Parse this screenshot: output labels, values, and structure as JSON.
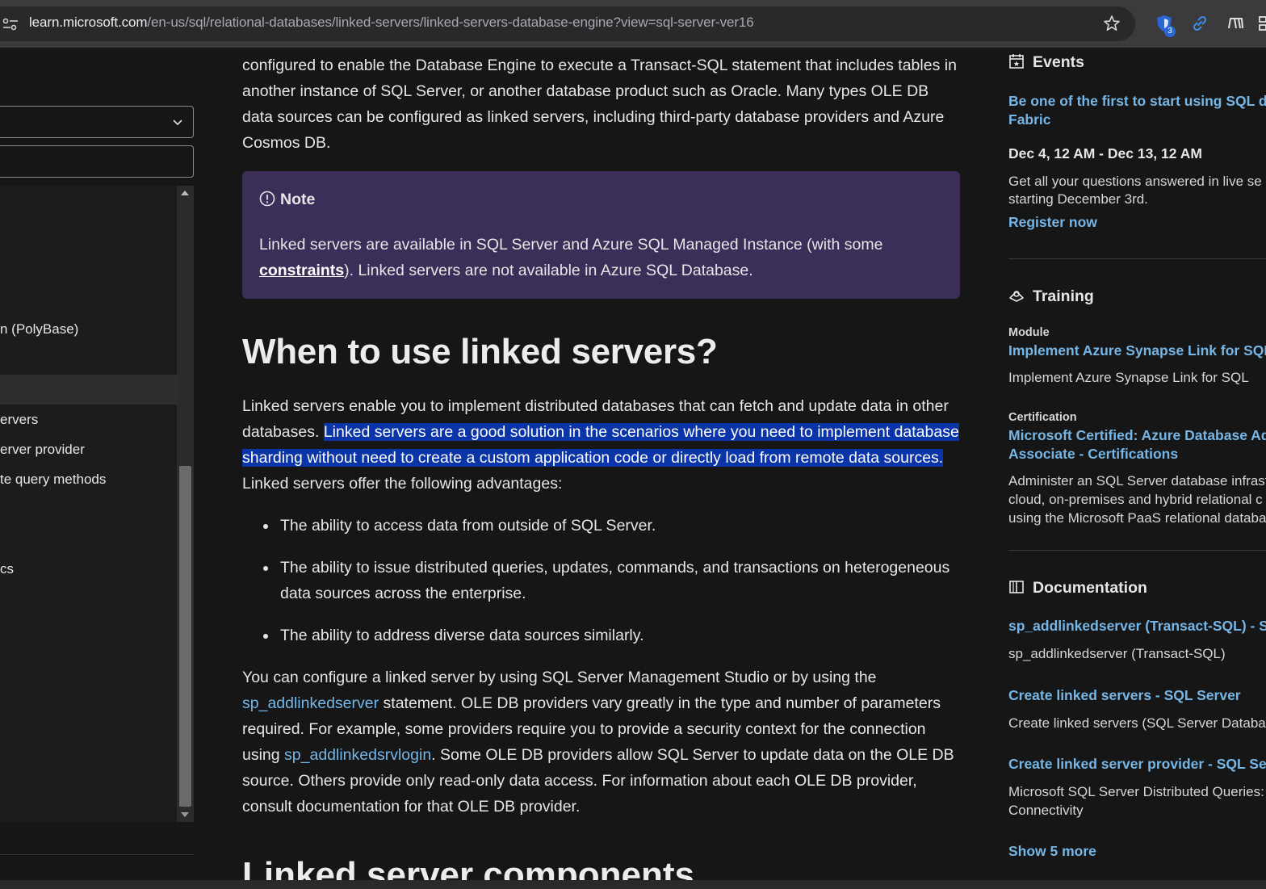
{
  "browser": {
    "url_host": "learn.microsoft.com",
    "url_path": "/en-us/sql/relational-databases/linked-servers/linked-servers-database-engine?view=sql-server-ver16",
    "extension_badge": "3"
  },
  "sidebar": {
    "items": [
      "n (PolyBase)",
      "ervers",
      "erver provider",
      "te query methods",
      "cs"
    ]
  },
  "main": {
    "intro_lines": "configured to enable the Database Engine to execute a Transact-SQL statement that includes tables in another instance of SQL Server, or another database product such as Oracle. Many types OLE DB data sources can be configured as linked servers, including third-party database providers and Azure Cosmos DB.",
    "note": {
      "title": "Note",
      "text_before": "Linked servers are available in SQL Server and Azure SQL Managed Instance (with some ",
      "link": "constraints",
      "text_after": "). Linked servers are not available in Azure SQL Database."
    },
    "heading": "When to use linked servers?",
    "para_start": "Linked servers enable you to implement distributed databases that can fetch and update data in other databases. ",
    "para_highlight": "Linked servers are a good solution in the scenarios where you need to implement database sharding without need to create a custom application code or directly load from remote data sources.",
    "para_end": " Linked servers offer the following advantages:",
    "bullets": [
      "The ability to access data from outside of SQL Server.",
      "The ability to issue distributed queries, updates, commands, and transactions on heterogeneous data sources across the enterprise.",
      "The ability to address diverse data sources similarly."
    ],
    "para3_a": "You can configure a linked server by using SQL Server Management Studio or by using the ",
    "para3_link1": "sp_addlinkedserver",
    "para3_b": " statement. OLE DB providers vary greatly in the type and number of parameters required. For example, some providers require you to provide a security context for the connection using ",
    "para3_link2": "sp_addlinkedsrvlogin",
    "para3_c": ". Some OLE DB providers allow SQL Server to update data on the OLE DB source. Others provide only read-only data access. For information about each OLE DB provider, consult documentation for that OLE DB provider.",
    "next_heading": "Linked server components"
  },
  "rail": {
    "events": {
      "heading": "Events",
      "link_line1": "Be one of the first to start using SQL dat",
      "link_line2": "Fabric",
      "dates": "Dec 4, 12 AM - Dec 13, 12 AM",
      "desc_line1": "Get all your questions answered in live se",
      "desc_line2": "starting December 3rd.",
      "register": "Register now"
    },
    "training": {
      "heading": "Training",
      "module_label": "Module",
      "module_link": "Implement Azure Synapse Link for SQL -",
      "module_desc": "Implement Azure Synapse Link for SQL",
      "cert_label": "Certification",
      "cert_link_line1": "Microsoft Certified: Azure Database Adm",
      "cert_link_line2": "Associate - Certifications",
      "cert_desc_line1": "Administer an SQL Server database infrast",
      "cert_desc_line2": "cloud, on-premises and hybrid relational c",
      "cert_desc_line3": "using the Microsoft PaaS relational databa"
    },
    "documentation": {
      "heading": "Documentation",
      "items": [
        {
          "link": "sp_addlinkedserver (Transact-SQL) - SQL",
          "desc": "sp_addlinkedserver (Transact-SQL)"
        },
        {
          "link": "Create linked servers - SQL Server",
          "desc": "Create linked servers (SQL Server Databas"
        },
        {
          "link": "Create linked server provider - SQL Serve",
          "desc": "Microsoft SQL Server Distributed Queries:",
          "desc2": "Connectivity"
        }
      ],
      "show_more": "Show 5 more"
    }
  }
}
